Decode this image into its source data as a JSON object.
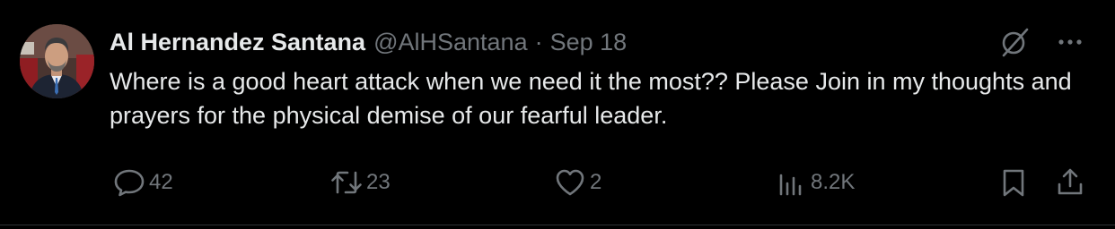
{
  "tweet": {
    "author": {
      "display_name": "Al Hernandez Santana",
      "handle": "@AlHSantana"
    },
    "separator": "·",
    "timestamp": "Sep 18",
    "text": "Where is a good heart attack when we need it the most?? Please Join in my thoughts and prayers for the physical demise of our fearful leader.",
    "icons": {
      "top_right": [
        "grok-icon",
        "more-icon"
      ],
      "actions": [
        "reply-icon",
        "retweet-icon",
        "like-icon",
        "views-icon",
        "bookmark-icon",
        "share-icon"
      ]
    },
    "stats": {
      "replies": "42",
      "retweets": "23",
      "likes": "2",
      "views": "8.2K"
    }
  },
  "colors": {
    "background": "#000000",
    "primary_text": "#e7e9ea",
    "secondary_text": "#71767b",
    "divider": "#2f3336"
  }
}
